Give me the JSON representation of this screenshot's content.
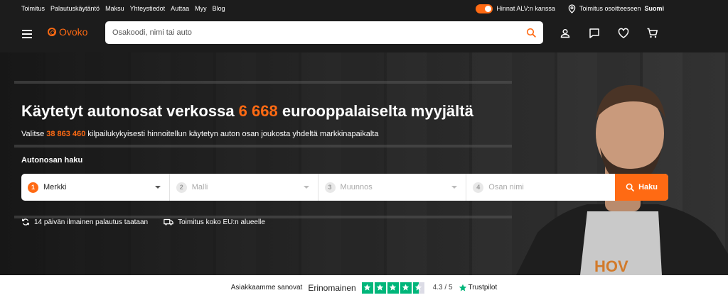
{
  "topbar": {
    "links": [
      "Toimitus",
      "Palautuskäytäntö",
      "Maksu",
      "Yhteystiedot",
      "Auttaa",
      "Myy",
      "Blog"
    ],
    "vat_label": "Hinnat ALV:n kanssa",
    "vat_enabled": true,
    "shipping_prefix": "Toimitus osoitteeseen",
    "shipping_country": "Suomi"
  },
  "navbar": {
    "logo": "Ovoko",
    "search_placeholder": "Osakoodi, nimi tai auto",
    "icons": [
      "account-icon",
      "chat-icon",
      "heart-icon",
      "cart-icon"
    ]
  },
  "hero": {
    "title_pre": "Käytetyt autonosat verkossa ",
    "title_highlight": "6 668",
    "title_post": " eurooppalaiselta myyjältä",
    "subtitle_pre": "Valitse ",
    "subtitle_highlight": "38 863 460",
    "subtitle_post": " kilpailukykyisesti hinnoitellun käytetyn auton osan joukosta yhdeltä markkinapaikalta",
    "search_label": "Autonosan haku",
    "fields": [
      {
        "num": "1",
        "label": "Merkki"
      },
      {
        "num": "2",
        "label": "Malli"
      },
      {
        "num": "3",
        "label": "Muunnos"
      },
      {
        "num": "4",
        "label": "Osan nimi"
      }
    ],
    "search_button": "Haku",
    "benefits": [
      "14 päivän ilmainen palautus taataan",
      "Toimitus koko EU:n alueelle"
    ]
  },
  "trust": {
    "prefix": "Asiakkaamme sanovat",
    "rating_word": "Erinomainen",
    "stars": 4.5,
    "score": "4.3 / 5",
    "brand": "Trustpilot"
  },
  "colors": {
    "accent": "#ff6a13",
    "dark": "#1c1c1c",
    "trustpilot_green": "#00b67a"
  }
}
